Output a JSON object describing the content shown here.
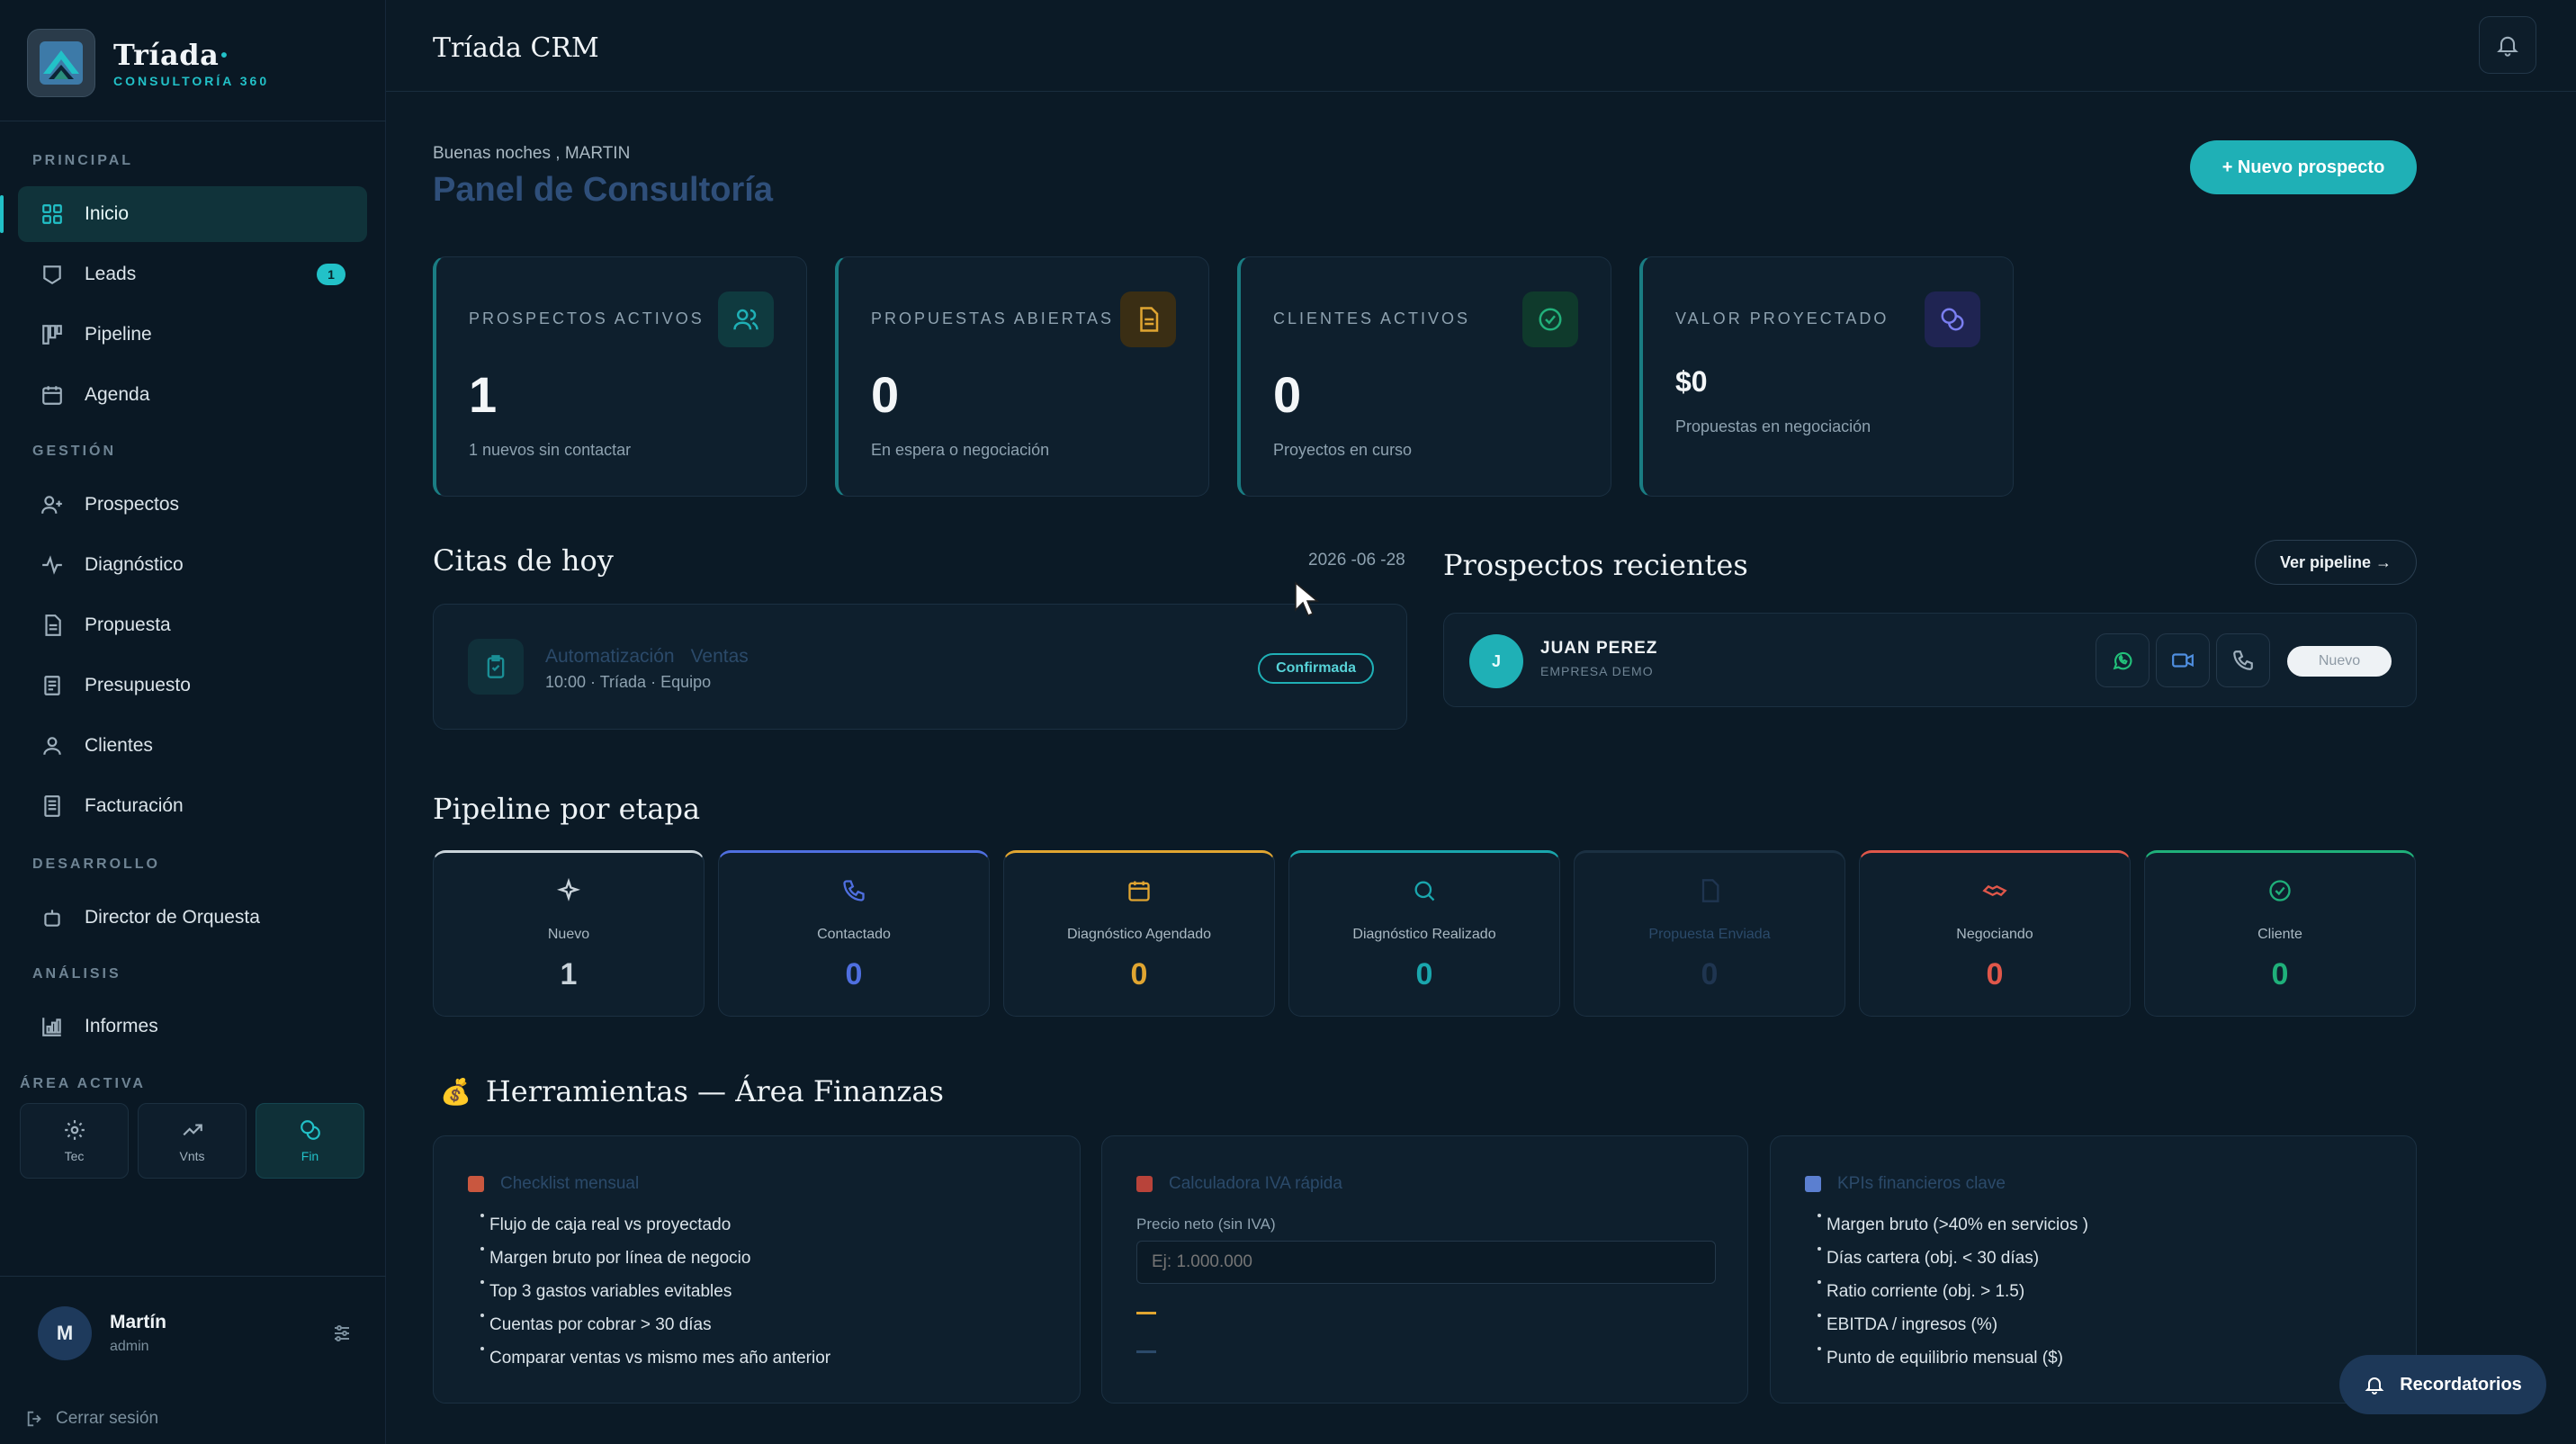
{
  "brand": {
    "name": "Tríada",
    "dot": "·",
    "subtitle": "CONSULTORÍA 360"
  },
  "sidebar": {
    "sections": {
      "principal": "PRINCIPAL",
      "gestion": "GESTIÓN",
      "desarrollo": "DESARROLLO",
      "analisis": "ANÁLISIS"
    },
    "items": {
      "inicio": "Inicio",
      "leads": "Leads",
      "leads_badge": "1",
      "pipeline": "Pipeline",
      "agenda": "Agenda",
      "prospectos": "Prospectos",
      "diagnostico": "Diagnóstico",
      "propuesta": "Propuesta",
      "presupuesto": "Presupuesto",
      "clientes": "Clientes",
      "facturacion": "Facturación",
      "director": "Director  de  Orquesta",
      "informes": "Informes"
    },
    "area": {
      "label": "ÁREA ACTIVA",
      "tiles": [
        "Tec",
        "Vnts",
        "Fin"
      ],
      "active": "Fin"
    },
    "user": {
      "initial": "M",
      "name": "Martín",
      "role": "admin"
    },
    "logout": "Cerrar  sesión"
  },
  "header": {
    "title": "Tríada CRM"
  },
  "main": {
    "greeting": "Buenas  noches , MARTIN",
    "page_title": "Panel de Consultoría",
    "new_prospect_button": "+ Nuevo  prospecto",
    "kpis": [
      {
        "label": "PROSPECTOS ACTIVOS",
        "value": "1",
        "sub": "1 nuevos  sin  contactar",
        "icon": "users-icon",
        "color": "#1fb0b6"
      },
      {
        "label": "PROPUESTAS ABIERTAS",
        "value": "0",
        "sub": "En espera  o negociación",
        "icon": "document-icon",
        "color": "#e0a531"
      },
      {
        "label": "CLIENTES ACTIVOS",
        "value": "0",
        "sub": "Proyectos  en curso",
        "icon": "check-circle-icon",
        "color": "#22b07a"
      },
      {
        "label": "VALOR PROYECTADO",
        "value": "$0",
        "sub": "Propuestas  en negociación",
        "icon": "coins-icon",
        "color": "#6b6ee0"
      }
    ],
    "citas": {
      "title": "Citas de hoy",
      "date": "2026 -06 -28",
      "items": [
        {
          "service": "Automatización",
          "area": "Ventas",
          "meta": "10:00  ·  Tríada   · Equipo",
          "status": "Confirmada"
        }
      ]
    },
    "recientes": {
      "title": "Prospectos recientes",
      "view_pipeline": "Ver pipeline  →",
      "items": [
        {
          "initial": "J",
          "name": "JUAN PEREZ",
          "company": "EMPRESA DEMO",
          "status": "Nuevo"
        }
      ]
    },
    "pipeline": {
      "title": "Pipeline por etapa",
      "stages": [
        {
          "name": "Nuevo",
          "count": "1",
          "color": "#c9d3da",
          "icon": "sparkle-icon"
        },
        {
          "name": "Contactado",
          "count": "0",
          "color": "#4f6fe0",
          "icon": "phone-icon"
        },
        {
          "name": "Diagnóstico   Agendado",
          "count": "0",
          "color": "#e0a531",
          "icon": "calendar-icon"
        },
        {
          "name": "Diagnóstico   Realizado",
          "count": "0",
          "color": "#1aa6ad",
          "icon": "search-icon"
        },
        {
          "name": "Propuesta   Enviada",
          "count": "0",
          "color": "#2b4a6a",
          "icon": "document-icon"
        },
        {
          "name": "Negociando",
          "count": "0",
          "color": "#e0574a",
          "icon": "handshake-icon"
        },
        {
          "name": "Cliente",
          "count": "0",
          "color": "#1fb07a",
          "icon": "check-circle-icon"
        }
      ]
    },
    "tools": {
      "title": "Herramientas — Área Finanzas",
      "bag_icon": "💰",
      "checklist": {
        "title": "Checklist   mensual",
        "items": [
          "Flujo de caja real vs proyectado",
          "Margen  bruto  por línea  de negocio",
          "Top 3 gastos  variables  evitables",
          "Cuentas  por cobrar  > 30 días",
          "Comparar  ventas  vs mismo  mes año anterior"
        ]
      },
      "calculator": {
        "title": "Calculadora   IVA  rápida",
        "label": "Precio  neto (sin IVA)",
        "placeholder": "Ej: 1.000.000"
      },
      "kpis": {
        "title": "KPIs  financieros   clave",
        "items": [
          "Margen  bruto  (>40% en servicios )",
          "Días  cartera  (obj. < 30 días)",
          "Ratio  corriente  (obj. > 1.5)",
          "EBITDA  / ingresos  (%)",
          "Punto  de equilibrio  mensual  ($)"
        ]
      }
    },
    "reminders_button": "Recordatorios"
  }
}
